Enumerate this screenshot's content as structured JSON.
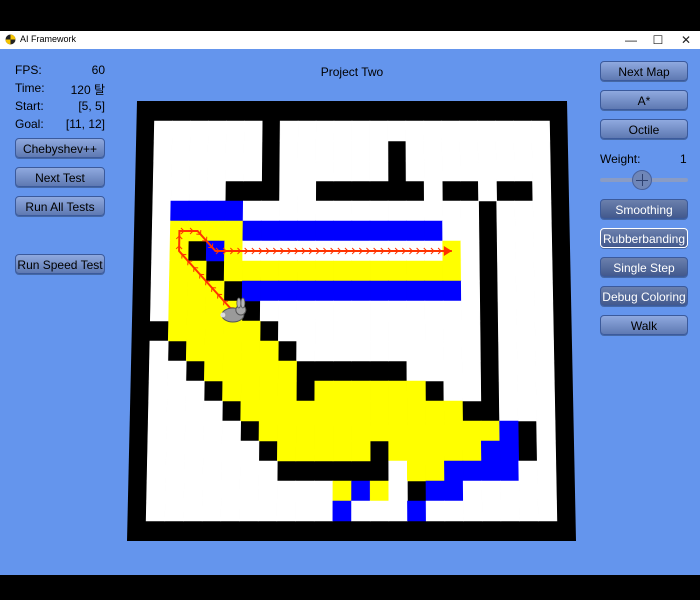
{
  "window": {
    "title": "AI Framework",
    "minimize_glyph": "—",
    "maximize_glyph": "☐",
    "close_glyph": "✕"
  },
  "stats": {
    "fps_label": "FPS:",
    "fps_value": "60",
    "time_label": "Time:",
    "time_value": "120 탈",
    "start_label": "Start:",
    "start_value": "[5, 5]",
    "goal_label": "Goal:",
    "goal_value": "[11, 12]"
  },
  "left_buttons": {
    "heuristic": "Chebyshev++",
    "next_test": "Next Test",
    "run_all_tests": "Run All Tests",
    "run_speed_test": "Run Speed Test"
  },
  "project_title": "Project Two",
  "right_panel": {
    "next_map": "Next Map",
    "algorithm": "A*",
    "distance": "Octile",
    "weight_label": "Weight:",
    "weight_value": "1",
    "weight_slider": 0.5,
    "smoothing": "Smoothing",
    "rubberbanding": "Rubberbanding",
    "single_step": "Single Step",
    "debug_coloring": "Debug Coloring",
    "walk": "Walk"
  },
  "colors": {
    "background": "#6495ed",
    "wall": "#000000",
    "open": "#ffffff",
    "closed_list": "#ffff00",
    "open_list": "#0000ff",
    "path": "#ff3300"
  },
  "grid": {
    "rows": [
      "########################",
      "#......#...............#",
      "#......#......#........#",
      "#......#......#........#",
      "#....###..######.##.##.#",
      "#.OOOO.............#...#",
      "#.YYYYOOOOOOOOOOO..#...#",
      "#.Y#OY...........P.#...#",
      "#.YY#YYYYYYYYYYYYY.#...#",
      "#.YYY#OOOOOOOOOOOO.#...#",
      "#.YYYY#............#...#",
      "##YYYYY#...........#...#",
      "#.#YYYYY#..........#...#",
      "#..#YYYYY######....#...#",
      "#...#YYYY#YYYYYY#..#...#",
      "#....#YYYYYYYYYYYY##...#",
      "#.....#YYYYYYYYYYYYYO#.#",
      "#......#YYYYY#YYYYYOO#.#",
      "#.......######.YYOOOO..#",
      "#..........YOY.#OO.....#",
      "#..........O...O.......#",
      "########################"
    ],
    "legend": {
      "#": "wall",
      ".": "open",
      "Y": "closed_list",
      "O": "open_list",
      "P": "agent_target"
    }
  }
}
